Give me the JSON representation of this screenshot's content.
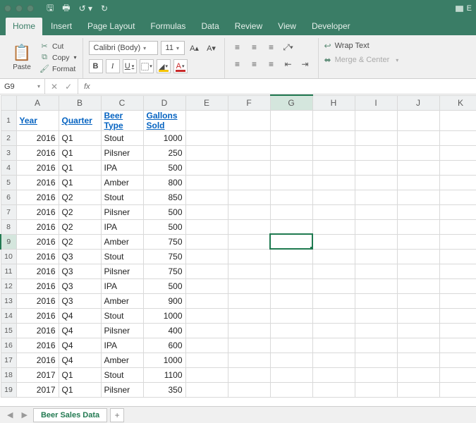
{
  "title_right": "E",
  "tabs": [
    "Home",
    "Insert",
    "Page Layout",
    "Formulas",
    "Data",
    "Review",
    "View",
    "Developer"
  ],
  "active_tab": 0,
  "clipboard": {
    "paste": "Paste",
    "cut": "Cut",
    "copy": "Copy",
    "format": "Format"
  },
  "font": {
    "name": "Calibri (Body)",
    "size": "11",
    "bold": "B",
    "italic": "I",
    "underline": "U"
  },
  "wrap": {
    "wrap_text": "Wrap Text",
    "merge": "Merge & Center"
  },
  "namebox": "G9",
  "fx": "fx",
  "cols": [
    "A",
    "B",
    "C",
    "D",
    "E",
    "F",
    "G",
    "H",
    "I",
    "J",
    "K"
  ],
  "selected_col": "G",
  "selected_row": 9,
  "headers": {
    "A": "Year",
    "B": "Quarter",
    "C": "Beer Type",
    "D": "Gallons Sold"
  },
  "rows": [
    {
      "A": "2016",
      "B": "Q1",
      "C": "Stout",
      "D": "1000"
    },
    {
      "A": "2016",
      "B": "Q1",
      "C": "Pilsner",
      "D": "250"
    },
    {
      "A": "2016",
      "B": "Q1",
      "C": "IPA",
      "D": "500"
    },
    {
      "A": "2016",
      "B": "Q1",
      "C": "Amber",
      "D": "800"
    },
    {
      "A": "2016",
      "B": "Q2",
      "C": "Stout",
      "D": "850"
    },
    {
      "A": "2016",
      "B": "Q2",
      "C": "Pilsner",
      "D": "500"
    },
    {
      "A": "2016",
      "B": "Q2",
      "C": "IPA",
      "D": "500"
    },
    {
      "A": "2016",
      "B": "Q2",
      "C": "Amber",
      "D": "750"
    },
    {
      "A": "2016",
      "B": "Q3",
      "C": "Stout",
      "D": "750"
    },
    {
      "A": "2016",
      "B": "Q3",
      "C": "Pilsner",
      "D": "750"
    },
    {
      "A": "2016",
      "B": "Q3",
      "C": "IPA",
      "D": "500"
    },
    {
      "A": "2016",
      "B": "Q3",
      "C": "Amber",
      "D": "900"
    },
    {
      "A": "2016",
      "B": "Q4",
      "C": "Stout",
      "D": "1000"
    },
    {
      "A": "2016",
      "B": "Q4",
      "C": "Pilsner",
      "D": "400"
    },
    {
      "A": "2016",
      "B": "Q4",
      "C": "IPA",
      "D": "600"
    },
    {
      "A": "2016",
      "B": "Q4",
      "C": "Amber",
      "D": "1000"
    },
    {
      "A": "2017",
      "B": "Q1",
      "C": "Stout",
      "D": "1100"
    },
    {
      "A": "2017",
      "B": "Q1",
      "C": "Pilsner",
      "D": "350"
    }
  ],
  "sheet_name": "Beer Sales Data",
  "accent": "#3a7d66"
}
